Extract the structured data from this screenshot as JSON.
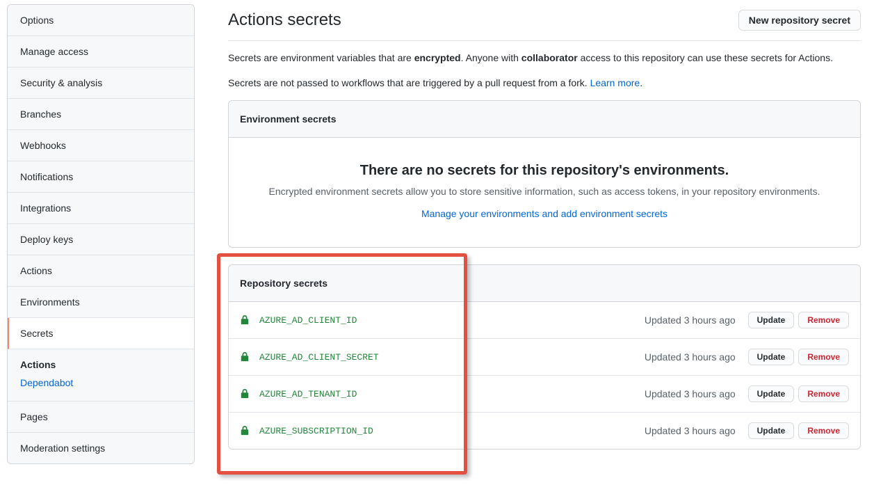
{
  "sidebar": {
    "items": [
      {
        "label": "Options"
      },
      {
        "label": "Manage access"
      },
      {
        "label": "Security & analysis"
      },
      {
        "label": "Branches"
      },
      {
        "label": "Webhooks"
      },
      {
        "label": "Notifications"
      },
      {
        "label": "Integrations"
      },
      {
        "label": "Deploy keys"
      },
      {
        "label": "Actions"
      },
      {
        "label": "Environments"
      },
      {
        "label": "Secrets",
        "active": true
      }
    ],
    "group": {
      "title": "Actions",
      "sublink": "Dependabot"
    },
    "tail": [
      {
        "label": "Pages"
      },
      {
        "label": "Moderation settings"
      }
    ]
  },
  "header": {
    "title": "Actions secrets",
    "new_button": "New repository secret"
  },
  "intro": {
    "p1_a": "Secrets are environment variables that are ",
    "p1_b": "encrypted",
    "p1_c": ". Anyone with ",
    "p1_d": "collaborator",
    "p1_e": " access to this repository can use these secrets for Actions.",
    "p2_a": "Secrets are not passed to workflows that are triggered by a pull request from a fork. ",
    "learn_more": "Learn more",
    "p2_b": "."
  },
  "env_box": {
    "header": "Environment secrets",
    "empty_title": "There are no secrets for this repository's environments.",
    "empty_desc": "Encrypted environment secrets allow you to store sensitive information, such as access tokens, in your repository environments.",
    "manage_link": "Manage your environments and add environment secrets"
  },
  "repo_box": {
    "header": "Repository secrets",
    "update_label": "Update",
    "remove_label": "Remove",
    "secrets": [
      {
        "name": "AZURE_AD_CLIENT_ID",
        "updated": "Updated 3 hours ago"
      },
      {
        "name": "AZURE_AD_CLIENT_SECRET",
        "updated": "Updated 3 hours ago"
      },
      {
        "name": "AZURE_AD_TENANT_ID",
        "updated": "Updated 3 hours ago"
      },
      {
        "name": "AZURE_SUBSCRIPTION_ID",
        "updated": "Updated 3 hours ago"
      }
    ]
  }
}
